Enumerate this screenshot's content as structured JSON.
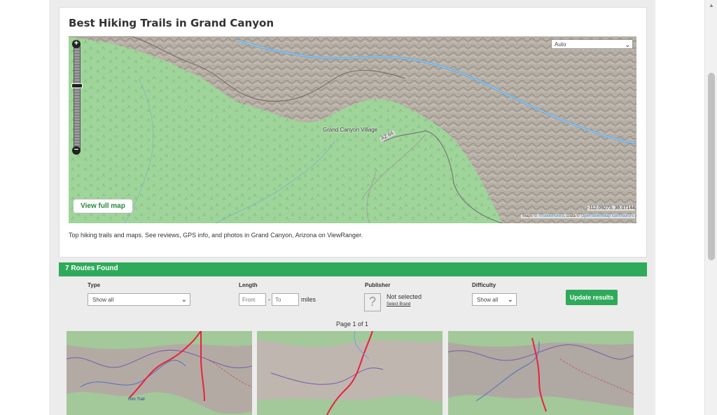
{
  "colors": {
    "accent_green": "#2faa5b",
    "link_green": "#27883e",
    "route_red": "#e8233a",
    "river_blue": "#6aa6d6",
    "forest_green": "#9fd59a"
  },
  "card": {
    "title": "Best Hiking Trails in Grand Canyon",
    "description": "Top hiking trails and maps. See reviews, GPS info, and photos in Grand Canyon, Arizona on ViewRanger."
  },
  "map": {
    "layer_select": "Auto",
    "place_label": "Grand Canyon Village",
    "road_label": "AZ 64",
    "view_full_label": "View full map",
    "coordinates": "-112.09273, 36.07144",
    "attribution_prefix": "Maps ©",
    "attribution_link1": "Thunderforest",
    "attribution_mid": ", Data ©",
    "attribution_link2": "OpenStreetMap contributors",
    "zoom_in_icon": "plus-icon",
    "zoom_out_icon": "minus-icon",
    "zoom_in": "+",
    "zoom_out": "−",
    "zoom_level": 0.38
  },
  "results": {
    "header": "7 Routes Found",
    "filters": {
      "type_label": "Type",
      "type_value": "Show all",
      "length_label": "Length",
      "from_placeholder": "From",
      "dash": "-",
      "to_placeholder": "To",
      "unit": "miles",
      "publisher_label": "Publisher",
      "publisher_value": "Not selected",
      "select_brand": "Select Brand",
      "difficulty_label": "Difficulty",
      "difficulty_value": "Show all",
      "update_button": "Update results"
    },
    "pager": "Page 1 of 1",
    "thumbnails": [
      {
        "caption": "Rim Trail"
      },
      {
        "caption": ""
      },
      {
        "caption": ""
      }
    ]
  }
}
